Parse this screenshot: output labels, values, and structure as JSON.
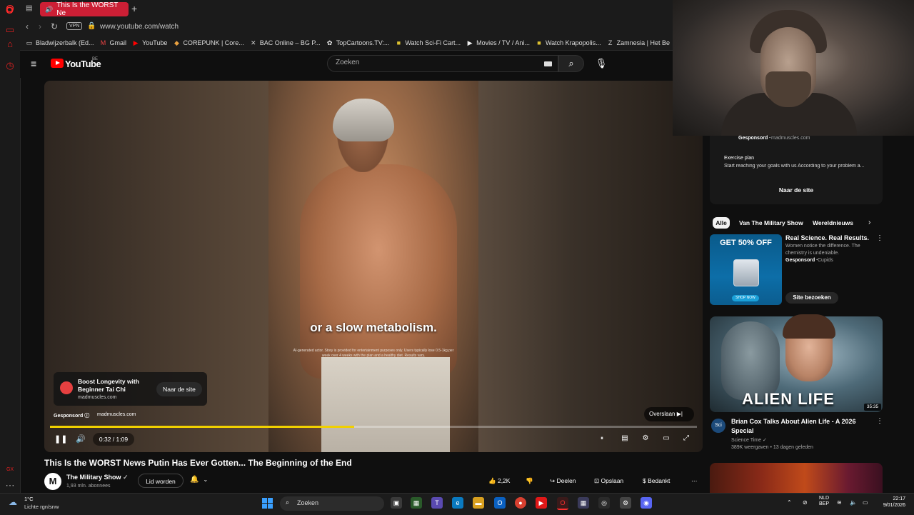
{
  "browser": {
    "active_tab_title": "This Is the WORST Ne",
    "new_tab_symbol": "+",
    "vpn_label": "VPN",
    "url": "www.youtube.com/watch",
    "bookmarks": [
      {
        "label": "Bladwijzerbalk (Ed...",
        "icon": "folder-icon"
      },
      {
        "label": "Gmail",
        "icon": "gmail-icon"
      },
      {
        "label": "YouTube",
        "icon": "youtube-icon"
      },
      {
        "label": "COREPUNK | Core...",
        "icon": "corepunk-icon"
      },
      {
        "label": "BAC Online – BG P...",
        "icon": "bac-icon"
      },
      {
        "label": "TopCartoons.TV:...",
        "icon": "topcartoons-icon"
      },
      {
        "label": "Watch Sci-Fi Cart...",
        "icon": "scifi-icon"
      },
      {
        "label": "Movies / TV / Ani...",
        "icon": "movies-icon"
      },
      {
        "label": "Watch Krapopolis...",
        "icon": "krapopolis-icon"
      },
      {
        "label": "Zamnesia | Het Be",
        "icon": "zamnesia-icon"
      }
    ]
  },
  "youtube": {
    "logo_text": "YouTube",
    "region": "BE",
    "search_placeholder": "Zoeken",
    "video": {
      "caption": "or a slow metabolism.",
      "disclaimer": "AI-generated actor. Story is provided for entertainment purposes only. Users typically lose 0.5-1kg per week over 4 weeks with the plan and a healthy diet. Results vary.",
      "time": "0:32 / 1:09",
      "progress": 0.47,
      "skip_label": "Overslaan"
    },
    "ad": {
      "title": "Boost Longevity with Beginner Tai Chi",
      "domain": "madmuscles.com",
      "visit_label": "Naar de site",
      "sponsored_label": "Gesponsord",
      "sponsored_domain": "madmuscles.com"
    },
    "title": "This Is the WORST News Putin Has Ever Gotten... The Beginning of the End",
    "channel": {
      "avatar_letter": "M",
      "name": "The Military Show",
      "subscribers": "1,93 mln. abonnees",
      "join_label": "Lid worden"
    },
    "actions": {
      "likes": "2,2K",
      "share": "Deelen",
      "save": "Opslaan",
      "thanks": "Bedankt",
      "more": "⋯"
    },
    "sidebar": {
      "sponsor_card": {
        "sponsored": "Gesponsord",
        "domain": "madmuscles.com",
        "plan_title": "Exercise plan",
        "plan_desc": "Start reaching your goals with us According to your problem a...",
        "visit_label": "Naar de site"
      },
      "chips": [
        "Alle",
        "Van The Military Show",
        "Wereldnieuws"
      ],
      "promo": {
        "headline": "GET 50% OFF",
        "shop_label": "SHOP NOW",
        "title": "Real Science. Real Results.",
        "desc": "Women notice the difference. The chemistry is undeniable.",
        "sponsored": "Gesponsord",
        "brand": "Cupids",
        "visit_label": "Site bezoeken"
      },
      "recommendation": {
        "thumb_text": "ALIEN LIFE",
        "duration": "35:35",
        "channel_avatar": "Sci",
        "title": "Brian Cox Talks About Alien Life - A 2026 Special",
        "channel": "Science Time",
        "meta": "389K weergaven • 13 dagen geleden"
      }
    }
  },
  "taskbar": {
    "temperature": "1°C",
    "weather": "Lichte rgn/snw",
    "search_label": "Zoeken",
    "lang_line1": "NLD",
    "lang_line2": "BEP",
    "time": "22:17",
    "date": "9/01/2026"
  }
}
